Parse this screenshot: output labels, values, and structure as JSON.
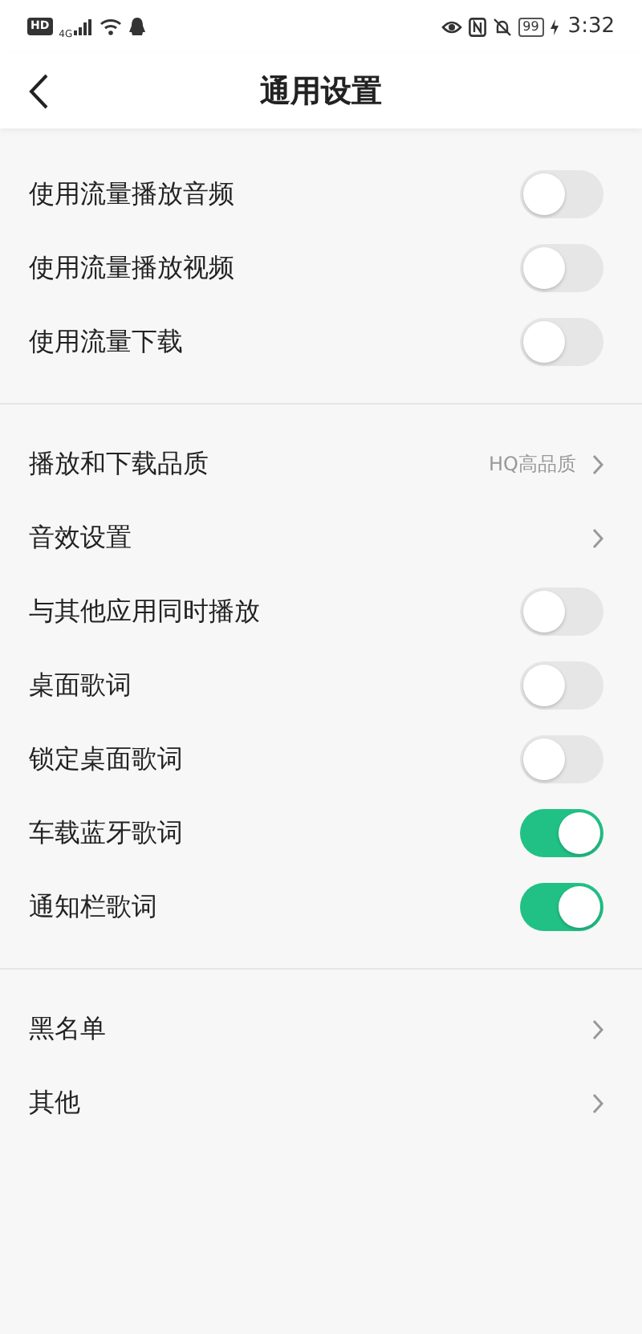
{
  "status_bar": {
    "hd": "HD",
    "network": "4G",
    "battery": "99",
    "time": "3:32"
  },
  "header": {
    "title": "通用设置"
  },
  "sections": [
    {
      "rows": [
        {
          "kind": "toggle",
          "label": "使用流量播放音频",
          "on": false
        },
        {
          "kind": "toggle",
          "label": "使用流量播放视频",
          "on": false
        },
        {
          "kind": "toggle",
          "label": "使用流量下载",
          "on": false
        }
      ]
    },
    {
      "rows": [
        {
          "kind": "link",
          "label": "播放和下载品质",
          "value": "HQ高品质"
        },
        {
          "kind": "link",
          "label": "音效设置"
        },
        {
          "kind": "toggle",
          "label": "与其他应用同时播放",
          "on": false
        },
        {
          "kind": "toggle",
          "label": "桌面歌词",
          "on": false
        },
        {
          "kind": "toggle",
          "label": "锁定桌面歌词",
          "on": false
        },
        {
          "kind": "toggle",
          "label": "车载蓝牙歌词",
          "on": true
        },
        {
          "kind": "toggle",
          "label": "通知栏歌词",
          "on": true
        }
      ]
    },
    {
      "rows": [
        {
          "kind": "link",
          "label": "黑名单"
        },
        {
          "kind": "link",
          "label": "其他"
        }
      ]
    }
  ]
}
